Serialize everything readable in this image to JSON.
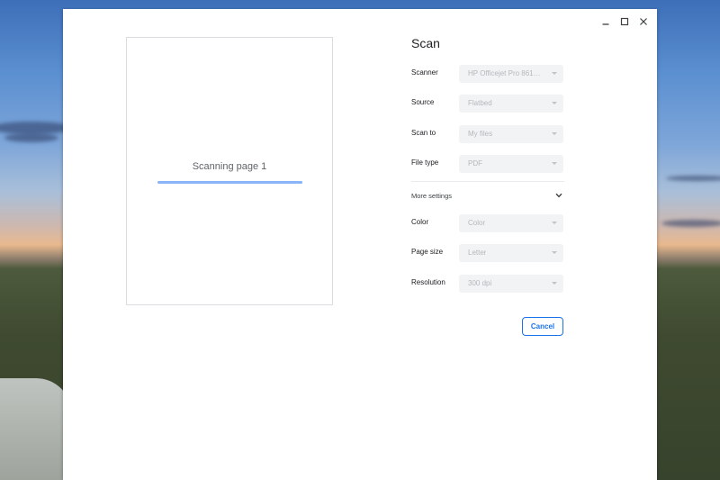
{
  "window": {
    "controls": [
      "minimize-icon",
      "maximize-icon",
      "close-icon"
    ]
  },
  "preview": {
    "status": "Scanning page 1",
    "progress_fraction": 1.0
  },
  "settings": {
    "title": "Scan",
    "rows": [
      {
        "label": "Scanner",
        "value": "HP Officejet Pro 8610 [..."
      },
      {
        "label": "Source",
        "value": "Flatbed"
      },
      {
        "label": "Scan to",
        "value": "My files"
      },
      {
        "label": "File type",
        "value": "PDF"
      }
    ],
    "more_settings": {
      "label": "More settings",
      "icon": "chevron-down-icon"
    },
    "more_rows": [
      {
        "label": "Color",
        "value": "Color"
      },
      {
        "label": "Page size",
        "value": "Letter"
      },
      {
        "label": "Resolution",
        "value": "300 dpi"
      }
    ],
    "cancel_label": "Cancel"
  },
  "colors": {
    "accent": "#1a73e8",
    "progress": "#8ab4f8",
    "select_bg": "#f1f3f4"
  }
}
